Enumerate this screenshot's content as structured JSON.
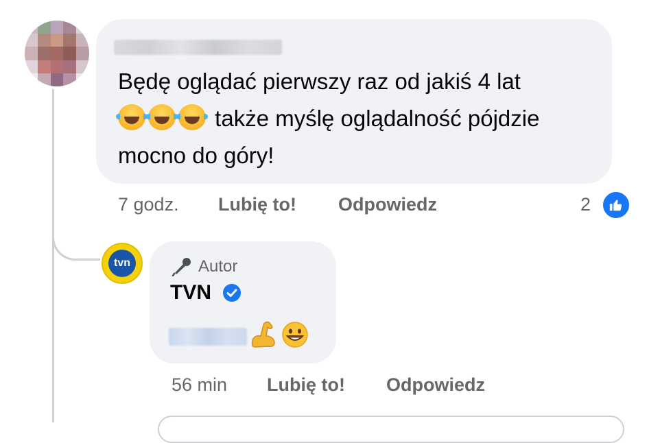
{
  "comment": {
    "line1": "Będę oglądać pierwszy raz od jakiś 4 lat",
    "line2": " także myślę oglądalność pójdzie",
    "line3": "mocno  do góry!",
    "emoji_icons": [
      "laugh-cry-emoji-icon",
      "laugh-cry-emoji-icon",
      "laugh-cry-emoji-icon"
    ],
    "time": "7 godz.",
    "like_label": "Lubię to!",
    "reply_label": "Odpowiedz",
    "like_count": "2"
  },
  "reply": {
    "badge_label": "Autor",
    "author_name": "TVN",
    "avatar_text": "tvn",
    "emoji_icons": [
      "flexed-biceps-emoji-icon",
      "grinning-emoji-icon"
    ],
    "time": "56 min",
    "like_label": "Lubię to!",
    "reply_label": "Odpowiedz"
  },
  "colors": {
    "bubble_bg": "#f0f2f5",
    "meta_text": "#65676b",
    "like_blue": "#1877f2",
    "tvn_yellow": "#f5d10b",
    "thread_line": "#ced0d4"
  }
}
